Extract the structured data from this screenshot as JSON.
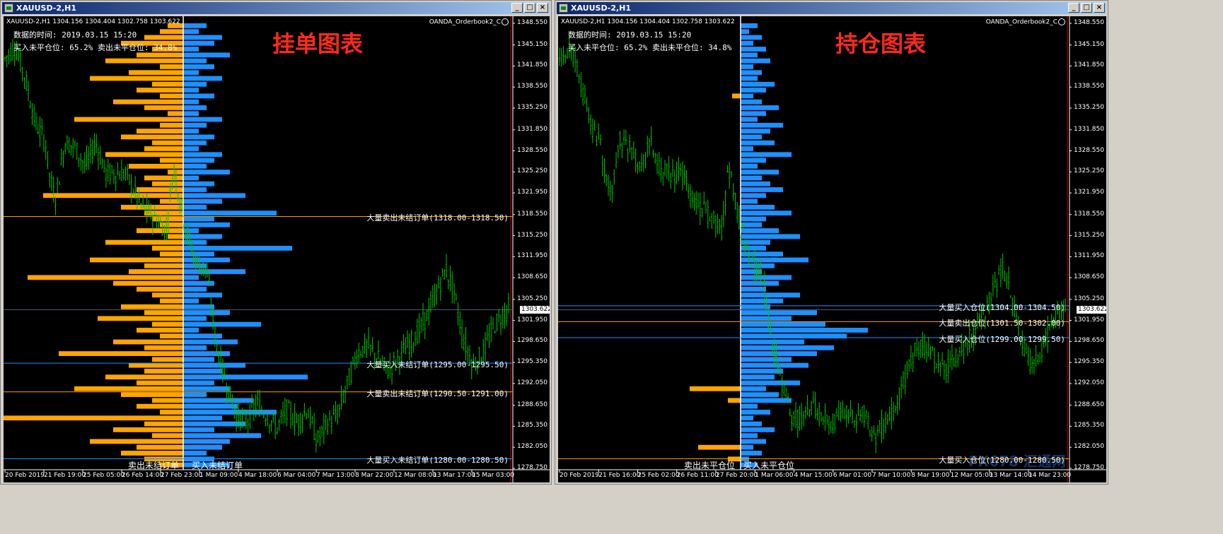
{
  "windows": [
    {
      "title": "XAUUSD-2,H1",
      "ohlc": "XAUUSD-2,H1  1304.156 1304.404 1302.758 1303.622",
      "indicator": "OANDA_Orderbook2_C",
      "data_time": "数据的时间: 2019.03.15 15:20",
      "ratio": "买入未平仓位: 65.2%  卖出未平仓位: 34.8%",
      "overlay_title": "挂单图表",
      "left_tag": "卖出未结订单",
      "right_tag": "买入未结订单",
      "levels": [
        {
          "text": "大量卖出未结订单(1318.00-1318.50)",
          "price": 1318.25,
          "color": "#ff9a00"
        },
        {
          "text": "大量买入未结订单(1295.00-1295.50)",
          "price": 1295.25,
          "color": "#1e90ff"
        },
        {
          "text": "大量卖出未结订单(1290.50-1291.00)",
          "price": 1290.75,
          "color": "#ff9a00"
        },
        {
          "text": "大量买入未结订单(1280.00-1280.50)",
          "price": 1280.25,
          "color": "#1e90ff"
        }
      ],
      "x_labels": [
        "20 Feb 2019",
        "21 Feb 19:00",
        "25 Feb 05:00",
        "26 Feb 14:00",
        "27 Feb 23:00",
        "1 Mar 09:00",
        "4 Mar 18:00",
        "6 Mar 04:00",
        "7 Mar 13:00",
        "8 Mar 22:00",
        "12 Mar 08:00",
        "13 Mar 17:00",
        "15 Mar 03:00"
      ],
      "current_price": "1303.622",
      "watermark": ""
    },
    {
      "title": "XAUUSD-2,H1",
      "ohlc": "XAUUSD-2,H1  1304.156 1304.404 1302.758 1303.622",
      "indicator": "OANDA_Orderbook2_C",
      "data_time": "数据的时间: 2019.03.15 15:20",
      "ratio": "买入未平仓位: 65.2%  卖出未平仓位: 34.8%",
      "overlay_title": "持仓图表",
      "left_tag": "卖出未平仓位",
      "right_tag": "买入未平仓位",
      "levels": [
        {
          "text": "大量买入仓位(1304.00-1304.50)",
          "price": 1304.25,
          "color": "#1e90ff"
        },
        {
          "text": "大量卖出仓位(1301.50-1302.00)",
          "price": 1301.75,
          "color": "#ff9a00"
        },
        {
          "text": "大量买入仓位(1299.00-1299.50)",
          "price": 1299.25,
          "color": "#1e90ff"
        },
        {
          "text": "大量买入仓位(1280.00-1280.50)",
          "price": 1280.25,
          "color": "#ff9a00"
        }
      ],
      "x_labels": [
        "20 Feb 2019",
        "21 Feb 16:00",
        "25 Feb 02:00",
        "26 Feb 11:00",
        "27 Feb 20:00",
        "1 Mar 06:00",
        "4 Mar 15:00",
        "6 Mar 01:00",
        "7 Mar 10:00",
        "8 Mar 19:00",
        "12 Mar 05:00",
        "13 Mar 14:00",
        "14 Mar 23:00"
      ],
      "current_price": "1303.622",
      "watermark": "FX678 汇通网"
    }
  ],
  "y_labels": [
    "1348.550",
    "1345.150",
    "1341.850",
    "1338.550",
    "1335.250",
    "1331.850",
    "1328.550",
    "1325.250",
    "1321.950",
    "1318.550",
    "1315.250",
    "1311.950",
    "1308.650",
    "1305.250",
    "1301.950",
    "1298.650",
    "1295.350",
    "1292.050",
    "1288.650",
    "1285.350",
    "1282.050",
    "1278.750"
  ],
  "colors": {
    "candle": "#00c800",
    "sell": "#ffa500",
    "buy": "#1e90ff",
    "title_red": "#ff2a1a",
    "redline": "#c00000"
  },
  "chart_data": [
    {
      "type": "bar",
      "title": "挂单图表",
      "series": [
        {
          "name": "卖出未结订单",
          "values": [
            2,
            3,
            5,
            8,
            4,
            6,
            10,
            3,
            7,
            12,
            4,
            6,
            3,
            9,
            5,
            2,
            14,
            3,
            6,
            8,
            4,
            5,
            10,
            3,
            7,
            2,
            5,
            4,
            6,
            18,
            3,
            8,
            5,
            4,
            3,
            6,
            2,
            10,
            4,
            3,
            12,
            5,
            7,
            20,
            9,
            6,
            4,
            3,
            8,
            5,
            11,
            4,
            6,
            3,
            9,
            5,
            16,
            4,
            7,
            5,
            10,
            6,
            14,
            8,
            4,
            6,
            3,
            25,
            5,
            9,
            4,
            12,
            6,
            8,
            5,
            3
          ]
        },
        {
          "name": "买入未结订单",
          "values": [
            3,
            2,
            5,
            4,
            2,
            6,
            3,
            4,
            2,
            5,
            3,
            2,
            4,
            2,
            3,
            2,
            5,
            3,
            2,
            4,
            3,
            2,
            5,
            4,
            3,
            6,
            2,
            4,
            3,
            8,
            5,
            3,
            12,
            4,
            6,
            2,
            5,
            3,
            14,
            4,
            6,
            3,
            8,
            2,
            4,
            3,
            5,
            2,
            4,
            6,
            3,
            10,
            2,
            5,
            7,
            3,
            6,
            4,
            8,
            5,
            16,
            4,
            6,
            3,
            9,
            7,
            12,
            5,
            8,
            4,
            10,
            6,
            5,
            3,
            4,
            6
          ]
        }
      ],
      "ylim": [
        1278.75,
        1348.55
      ]
    },
    {
      "type": "bar",
      "title": "持仓图表",
      "series": [
        {
          "name": "卖出未平仓位",
          "values": [
            0,
            0,
            0,
            0,
            0,
            0,
            0,
            0,
            0,
            0,
            0,
            0,
            2,
            0,
            0,
            0,
            0,
            0,
            0,
            0,
            0,
            0,
            0,
            0,
            0,
            0,
            0,
            0,
            0,
            0,
            0,
            0,
            0,
            0,
            0,
            0,
            0,
            0,
            0,
            0,
            0,
            0,
            0,
            0,
            0,
            0,
            0,
            0,
            0,
            0,
            0,
            0,
            0,
            0,
            0,
            0,
            0,
            0,
            0,
            0,
            0,
            0,
            12,
            0,
            3,
            0,
            0,
            0,
            0,
            0,
            0,
            0,
            10,
            0,
            3,
            0
          ]
        },
        {
          "name": "买入未平仓位",
          "values": [
            4,
            2,
            5,
            3,
            6,
            4,
            7,
            3,
            5,
            4,
            8,
            6,
            3,
            5,
            9,
            6,
            4,
            10,
            7,
            5,
            8,
            3,
            12,
            6,
            4,
            9,
            5,
            7,
            10,
            6,
            4,
            8,
            12,
            6,
            5,
            9,
            14,
            7,
            6,
            10,
            16,
            8,
            5,
            12,
            9,
            6,
            14,
            10,
            7,
            18,
            12,
            20,
            30,
            25,
            15,
            22,
            18,
            12,
            16,
            10,
            8,
            14,
            6,
            9,
            12,
            4,
            7,
            3,
            5,
            8,
            4,
            6,
            3,
            5,
            2,
            4
          ]
        }
      ],
      "ylim": [
        1278.75,
        1348.55
      ]
    }
  ]
}
